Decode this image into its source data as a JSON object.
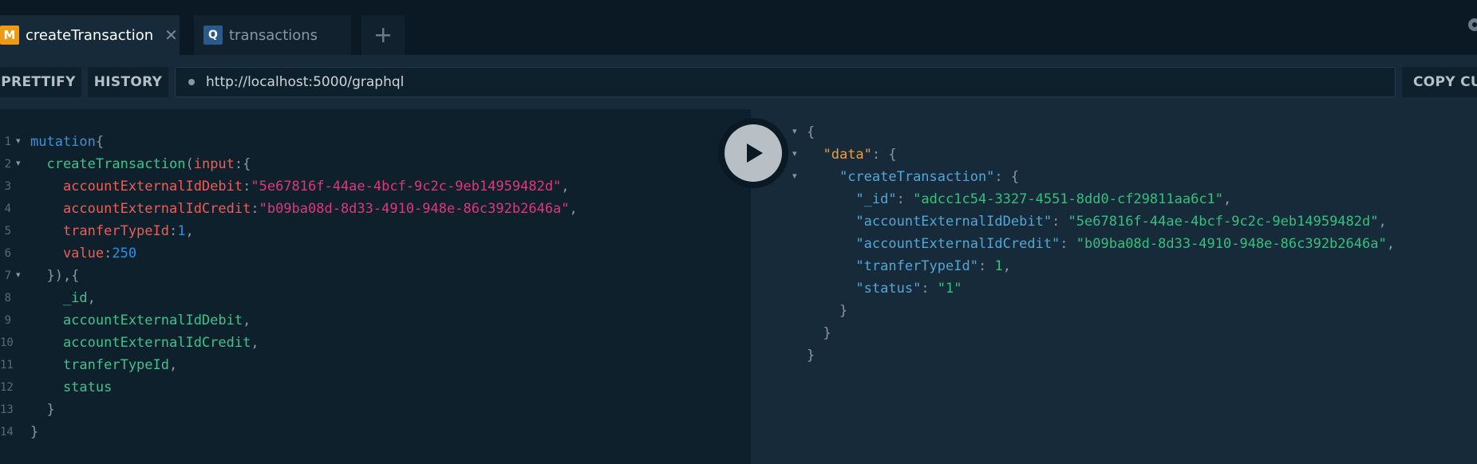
{
  "tabs": [
    {
      "badge": "M",
      "badge_color": "#f09a14",
      "title": "createTransaction",
      "close": "✕"
    },
    {
      "badge": "Q",
      "badge_color": "#2a5a8a",
      "title": "transactions"
    }
  ],
  "toolbar": {
    "prettify": "PRETTIFY",
    "history": "HISTORY",
    "url": "http://localhost:5000/graphql",
    "copy_curl": "COPY CU"
  },
  "query_lines": [
    {
      "num": "1",
      "fold": "▾",
      "tokens": [
        {
          "t": "mutation",
          "c": "k"
        },
        {
          "t": "{",
          "c": "p"
        }
      ]
    },
    {
      "num": "2",
      "fold": "▾",
      "tokens": [
        {
          "t": "  createTransaction",
          "c": "f"
        },
        {
          "t": "(",
          "c": "p"
        },
        {
          "t": "input",
          "c": "a"
        },
        {
          "t": ":{",
          "c": "p"
        }
      ]
    },
    {
      "num": "3",
      "tokens": [
        {
          "t": "    accountExternalIdDebit",
          "c": "a"
        },
        {
          "t": ":",
          "c": "p"
        },
        {
          "t": "\"5e67816f-44ae-4bcf-9c2c-9eb14959482d\"",
          "c": "s"
        },
        {
          "t": ",",
          "c": "p"
        }
      ]
    },
    {
      "num": "4",
      "tokens": [
        {
          "t": "    accountExternalIdCredit",
          "c": "a"
        },
        {
          "t": ":",
          "c": "p"
        },
        {
          "t": "\"b09ba08d-8d33-4910-948e-86c392b2646a\"",
          "c": "s"
        },
        {
          "t": ",",
          "c": "p"
        }
      ]
    },
    {
      "num": "5",
      "tokens": [
        {
          "t": "    tranferTypeId",
          "c": "a"
        },
        {
          "t": ":",
          "c": "p"
        },
        {
          "t": "1",
          "c": "n"
        },
        {
          "t": ",",
          "c": "p"
        }
      ]
    },
    {
      "num": "6",
      "tokens": [
        {
          "t": "    value",
          "c": "a"
        },
        {
          "t": ":",
          "c": "p"
        },
        {
          "t": "250",
          "c": "n"
        }
      ]
    },
    {
      "num": "7",
      "fold": "▾",
      "tokens": [
        {
          "t": "  }),{",
          "c": "p"
        }
      ]
    },
    {
      "num": "8",
      "tokens": [
        {
          "t": "    _id",
          "c": "f"
        },
        {
          "t": ",",
          "c": "p"
        }
      ]
    },
    {
      "num": "9",
      "tokens": [
        {
          "t": "    accountExternalIdDebit",
          "c": "f"
        },
        {
          "t": ",",
          "c": "p"
        }
      ]
    },
    {
      "num": "10",
      "tokens": [
        {
          "t": "    accountExternalIdCredit",
          "c": "f"
        },
        {
          "t": ",",
          "c": "p"
        }
      ]
    },
    {
      "num": "11",
      "tokens": [
        {
          "t": "    tranferTypeId",
          "c": "f"
        },
        {
          "t": ",",
          "c": "p"
        }
      ]
    },
    {
      "num": "12",
      "tokens": [
        {
          "t": "    status",
          "c": "f"
        }
      ]
    },
    {
      "num": "13",
      "tokens": [
        {
          "t": "  }",
          "c": "p"
        }
      ]
    },
    {
      "num": "14",
      "tokens": [
        {
          "t": "}",
          "c": "p"
        }
      ]
    }
  ],
  "result_lines": [
    {
      "fold": "▾",
      "tokens": [
        {
          "t": "{",
          "c": "p"
        }
      ]
    },
    {
      "fold": "▾",
      "tokens": [
        {
          "t": "  ",
          "c": "p"
        },
        {
          "t": "\"data\"",
          "c": "ro"
        },
        {
          "t": ": {",
          "c": "p"
        }
      ]
    },
    {
      "fold": "▾",
      "tokens": [
        {
          "t": "    ",
          "c": "p"
        },
        {
          "t": "\"createTransaction\"",
          "c": "rk"
        },
        {
          "t": ": {",
          "c": "p"
        }
      ]
    },
    {
      "tokens": [
        {
          "t": "      ",
          "c": "p"
        },
        {
          "t": "\"_id\"",
          "c": "rk"
        },
        {
          "t": ": ",
          "c": "p"
        },
        {
          "t": "\"adcc1c54-3327-4551-8dd0-cf29811aa6c1\"",
          "c": "rs"
        },
        {
          "t": ",",
          "c": "p"
        }
      ]
    },
    {
      "tokens": [
        {
          "t": "      ",
          "c": "p"
        },
        {
          "t": "\"accountExternalIdDebit\"",
          "c": "rk"
        },
        {
          "t": ": ",
          "c": "p"
        },
        {
          "t": "\"5e67816f-44ae-4bcf-9c2c-9eb14959482d\"",
          "c": "rs"
        },
        {
          "t": ",",
          "c": "p"
        }
      ]
    },
    {
      "tokens": [
        {
          "t": "      ",
          "c": "p"
        },
        {
          "t": "\"accountExternalIdCredit\"",
          "c": "rk"
        },
        {
          "t": ": ",
          "c": "p"
        },
        {
          "t": "\"b09ba08d-8d33-4910-948e-86c392b2646a\"",
          "c": "rs"
        },
        {
          "t": ",",
          "c": "p"
        }
      ]
    },
    {
      "tokens": [
        {
          "t": "      ",
          "c": "p"
        },
        {
          "t": "\"tranferTypeId\"",
          "c": "rk"
        },
        {
          "t": ": ",
          "c": "p"
        },
        {
          "t": "1",
          "c": "rn"
        },
        {
          "t": ",",
          "c": "p"
        }
      ]
    },
    {
      "tokens": [
        {
          "t": "      ",
          "c": "p"
        },
        {
          "t": "\"status\"",
          "c": "rk"
        },
        {
          "t": ": ",
          "c": "p"
        },
        {
          "t": "\"1\"",
          "c": "rs"
        }
      ]
    },
    {
      "tokens": [
        {
          "t": "    }",
          "c": "p"
        }
      ]
    },
    {
      "tokens": [
        {
          "t": "  }",
          "c": "p"
        }
      ]
    },
    {
      "tokens": [
        {
          "t": "}",
          "c": "p"
        }
      ]
    }
  ]
}
